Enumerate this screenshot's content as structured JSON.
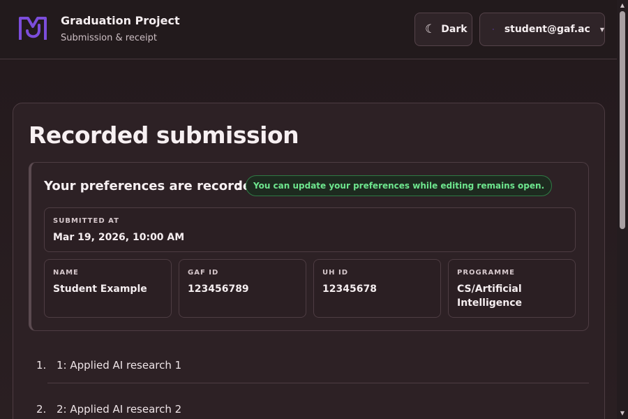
{
  "header": {
    "title": "Graduation Project",
    "subtitle": "Submission & receipt",
    "theme_label": "Dark",
    "user_email": "student@gaf.ac"
  },
  "main": {
    "page_title": "Recorded submission",
    "preferences_title": "Your preferences are recorded",
    "preferences_separator": ":",
    "status_badge": "You can update your preferences while editing remains open.",
    "fields": {
      "submitted_at": {
        "label": "SUBMITTED AT",
        "value": "Mar 19, 2026, 10:00 AM"
      },
      "name": {
        "label": "NAME",
        "value": "Student Example"
      },
      "gaf_id": {
        "label": "GAF ID",
        "value": "123456789"
      },
      "uh_id": {
        "label": "UH ID",
        "value": "12345678"
      },
      "programme": {
        "label": "PROGRAMME",
        "value": "CS/Artificial Intelligence"
      }
    },
    "preferences": [
      {
        "number": "1.",
        "label": "1: Applied AI research 1"
      },
      {
        "number": "2.",
        "label": "2: Applied AI research 2"
      }
    ]
  },
  "icons": {
    "logo": "logo-icon",
    "theme": "moon-icon",
    "user": "user-icon",
    "caret": "chevron-down-icon"
  },
  "colors": {
    "accent": "#7c4ddb",
    "success": "#6ee68e",
    "background": "#231a1d"
  }
}
